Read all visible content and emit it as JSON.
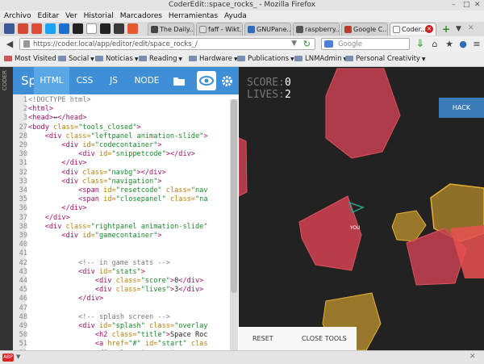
{
  "window": {
    "title": "CoderEdit::space_rocks_ - Mozilla Firefox"
  },
  "menu": [
    "Archivo",
    "Editar",
    "Ver",
    "Historial",
    "Marcadores",
    "Herramientas",
    "Ayuda"
  ],
  "tabs": [
    {
      "label": "The Daily...",
      "active": false
    },
    {
      "label": "faff - Wikt...",
      "active": false
    },
    {
      "label": "GNUPane...",
      "active": false
    },
    {
      "label": "raspberry...",
      "active": false
    },
    {
      "label": "Google C...",
      "active": false
    },
    {
      "label": "Coder...",
      "active": true
    }
  ],
  "navbar": {
    "url": "https://coder.local/app/editor/edit/space_rocks_/",
    "search_placeholder": "Google"
  },
  "bookmarks": [
    {
      "label": "Most Visited",
      "folder": false
    },
    {
      "label": "Social",
      "folder": true
    },
    {
      "label": "Noticias",
      "folder": true
    },
    {
      "label": "Reading",
      "folder": true
    },
    {
      "label": "Hardware",
      "folder": true
    },
    {
      "label": "Publications",
      "folder": true
    },
    {
      "label": "LNMAdmin",
      "folder": true
    },
    {
      "label": "Personal Creativity",
      "folder": true
    }
  ],
  "editor": {
    "side_label": "CODER",
    "brand": "Sp",
    "tabs": [
      "HTML",
      "CSS",
      "JS",
      "NODE"
    ],
    "active_tab": "HTML",
    "lines": [
      {
        "n": "1",
        "parts": [
          [
            "<!DOCTYPE html>",
            "cm"
          ]
        ]
      },
      {
        "n": "2",
        "parts": [
          [
            "<html>",
            "tg"
          ]
        ]
      },
      {
        "n": "3",
        "parts": [
          [
            "<head>",
            "tg"
          ],
          [
            "↔",
            "tx"
          ],
          [
            "</head>",
            "tg"
          ]
        ]
      },
      {
        "n": "27",
        "parts": [
          [
            "<body ",
            "tg"
          ],
          [
            "class=",
            "at"
          ],
          [
            "\"tools_closed\"",
            "st"
          ],
          [
            ">",
            "tg"
          ]
        ]
      },
      {
        "n": "28",
        "parts": [
          [
            "    <div ",
            "tg"
          ],
          [
            "class=",
            "at"
          ],
          [
            "\"leftpanel animation-slide\"",
            "st"
          ],
          [
            ">",
            "tg"
          ]
        ]
      },
      {
        "n": "29",
        "parts": [
          [
            "        <div ",
            "tg"
          ],
          [
            "id=",
            "at"
          ],
          [
            "\"codecontainer\"",
            "st"
          ],
          [
            ">",
            "tg"
          ]
        ]
      },
      {
        "n": "30",
        "parts": [
          [
            "            <div ",
            "tg"
          ],
          [
            "id=",
            "at"
          ],
          [
            "\"snippetcode\"",
            "st"
          ],
          [
            "></div>",
            "tg"
          ]
        ]
      },
      {
        "n": "31",
        "parts": [
          [
            "        </div>",
            "tg"
          ]
        ]
      },
      {
        "n": "32",
        "parts": [
          [
            "        <div ",
            "tg"
          ],
          [
            "class=",
            "at"
          ],
          [
            "\"navbg\"",
            "st"
          ],
          [
            "></div>",
            "tg"
          ]
        ]
      },
      {
        "n": "33",
        "parts": [
          [
            "        <div ",
            "tg"
          ],
          [
            "class=",
            "at"
          ],
          [
            "\"navigation\"",
            "st"
          ],
          [
            ">",
            "tg"
          ]
        ]
      },
      {
        "n": "34",
        "parts": [
          [
            "            <span ",
            "tg"
          ],
          [
            "id=",
            "at"
          ],
          [
            "\"resetcode\"",
            "st"
          ],
          [
            " class=",
            "at"
          ],
          [
            "\"nav",
            "st"
          ]
        ]
      },
      {
        "n": "35",
        "parts": [
          [
            "            <span ",
            "tg"
          ],
          [
            "id=",
            "at"
          ],
          [
            "\"closepanel\"",
            "st"
          ],
          [
            " class=",
            "at"
          ],
          [
            "\"na",
            "st"
          ]
        ]
      },
      {
        "n": "36",
        "parts": [
          [
            "        </div>",
            "tg"
          ]
        ]
      },
      {
        "n": "37",
        "parts": [
          [
            "    </div>",
            "tg"
          ]
        ]
      },
      {
        "n": "38",
        "parts": [
          [
            "    <div ",
            "tg"
          ],
          [
            "class=",
            "at"
          ],
          [
            "\"rightpanel animation-slide\"",
            "st"
          ]
        ]
      },
      {
        "n": "39",
        "parts": [
          [
            "        <div ",
            "tg"
          ],
          [
            "id=",
            "at"
          ],
          [
            "\"gamecontainer\"",
            "st"
          ],
          [
            ">",
            "tg"
          ]
        ]
      },
      {
        "n": "40",
        "parts": []
      },
      {
        "n": "41",
        "parts": []
      },
      {
        "n": "42",
        "parts": [
          [
            "            <!-- in game stats -->",
            "cm"
          ]
        ]
      },
      {
        "n": "43",
        "parts": [
          [
            "            <div ",
            "tg"
          ],
          [
            "id=",
            "at"
          ],
          [
            "\"stats\"",
            "st"
          ],
          [
            ">",
            "tg"
          ]
        ]
      },
      {
        "n": "44",
        "parts": [
          [
            "                <div ",
            "tg"
          ],
          [
            "class=",
            "at"
          ],
          [
            "\"score\"",
            "st"
          ],
          [
            ">",
            "tg"
          ],
          [
            "0",
            "tx"
          ],
          [
            "</div>",
            "tg"
          ]
        ]
      },
      {
        "n": "45",
        "parts": [
          [
            "                <div ",
            "tg"
          ],
          [
            "class=",
            "at"
          ],
          [
            "\"lives\"",
            "st"
          ],
          [
            ">",
            "tg"
          ],
          [
            "3",
            "tx"
          ],
          [
            "</div>",
            "tg"
          ]
        ]
      },
      {
        "n": "46",
        "parts": [
          [
            "            </div>",
            "tg"
          ]
        ]
      },
      {
        "n": "47",
        "parts": []
      },
      {
        "n": "48",
        "parts": [
          [
            "            <!-- splash screen -->",
            "cm"
          ]
        ]
      },
      {
        "n": "49",
        "parts": [
          [
            "            <div ",
            "tg"
          ],
          [
            "id=",
            "at"
          ],
          [
            "\"splash\"",
            "st"
          ],
          [
            " class=",
            "at"
          ],
          [
            "\"overlay",
            "st"
          ]
        ]
      },
      {
        "n": "50",
        "parts": [
          [
            "                <h2 ",
            "tg"
          ],
          [
            "class=",
            "at"
          ],
          [
            "\"title\"",
            "st"
          ],
          [
            ">",
            "tg"
          ],
          [
            "Space Roc",
            "tx"
          ]
        ]
      },
      {
        "n": "51",
        "parts": [
          [
            "                <a ",
            "tg"
          ],
          [
            "href=",
            "at"
          ],
          [
            "\"#\"",
            "st"
          ],
          [
            " id=",
            "at"
          ],
          [
            "\"start\"",
            "st"
          ],
          [
            " clas",
            "at"
          ]
        ]
      },
      {
        "n": "52",
        "parts": [
          [
            "                <div ",
            "tg"
          ],
          [
            "class=",
            "at"
          ],
          [
            "\"scores\"",
            "st"
          ],
          [
            ">",
            "tg"
          ]
        ]
      }
    ]
  },
  "game": {
    "score_label": "SCORE:",
    "score": "0",
    "lives_label": "LIVES:",
    "lives": "2",
    "hack_label": "HACK",
    "ship_label": "YOU",
    "reset_label": "RESET",
    "close_tools_label": "CLOSE TOOLS"
  },
  "colors": {
    "accent": "#3e8fd6",
    "game_bg": "#222222",
    "rock_red": "#c84050",
    "rock_orange": "#e8b030",
    "ship": "#2aa08a"
  }
}
